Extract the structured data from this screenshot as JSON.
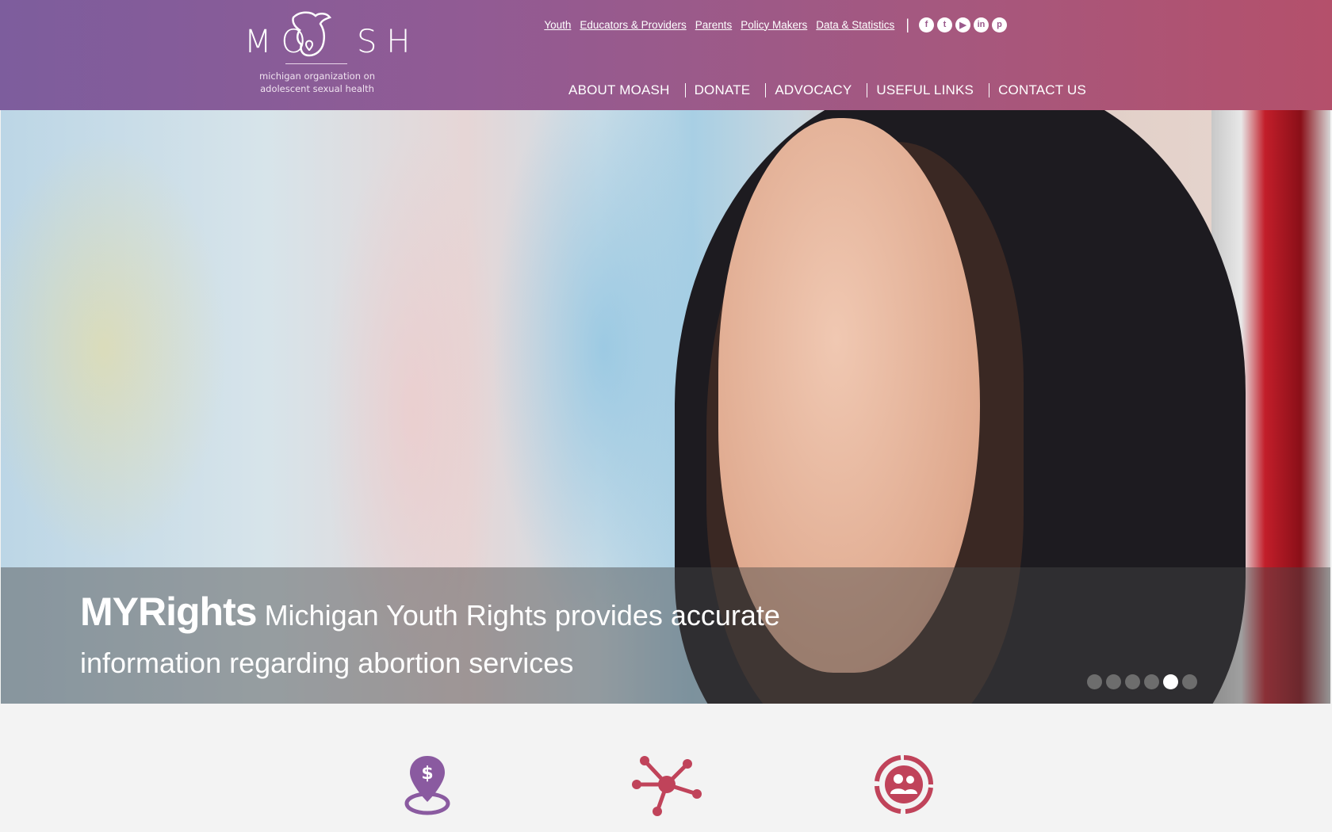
{
  "logo": {
    "wordmark": "MOSH",
    "wordmark_left": "MO",
    "wordmark_right": "SH",
    "tagline_line1": "michigan organization on",
    "tagline_line2": "adolescent sexual health"
  },
  "top_links": [
    "Youth",
    "Educators & Providers",
    "Parents",
    "Policy Makers",
    "Data & Statistics"
  ],
  "social_icons": [
    "facebook-icon",
    "twitter-icon",
    "youtube-icon",
    "linkedin-icon",
    "pinterest-icon"
  ],
  "main_nav": [
    "ABOUT MOASH",
    "DONATE",
    "ADVOCACY",
    "USEFUL LINKS",
    "CONTACT US"
  ],
  "hero": {
    "brand": "MYRights",
    "text": "Michigan Youth Rights provides accurate information regarding abortion services",
    "slide_count": 6,
    "active_slide": 5
  },
  "feature_icons": [
    "location-dollar-icon",
    "network-icon",
    "group-cycle-icon"
  ],
  "colors": {
    "header_start": "#7d5d9d",
    "header_end": "#b4506b",
    "icon_purple": "#8a5aa0",
    "icon_red": "#c0435a"
  }
}
